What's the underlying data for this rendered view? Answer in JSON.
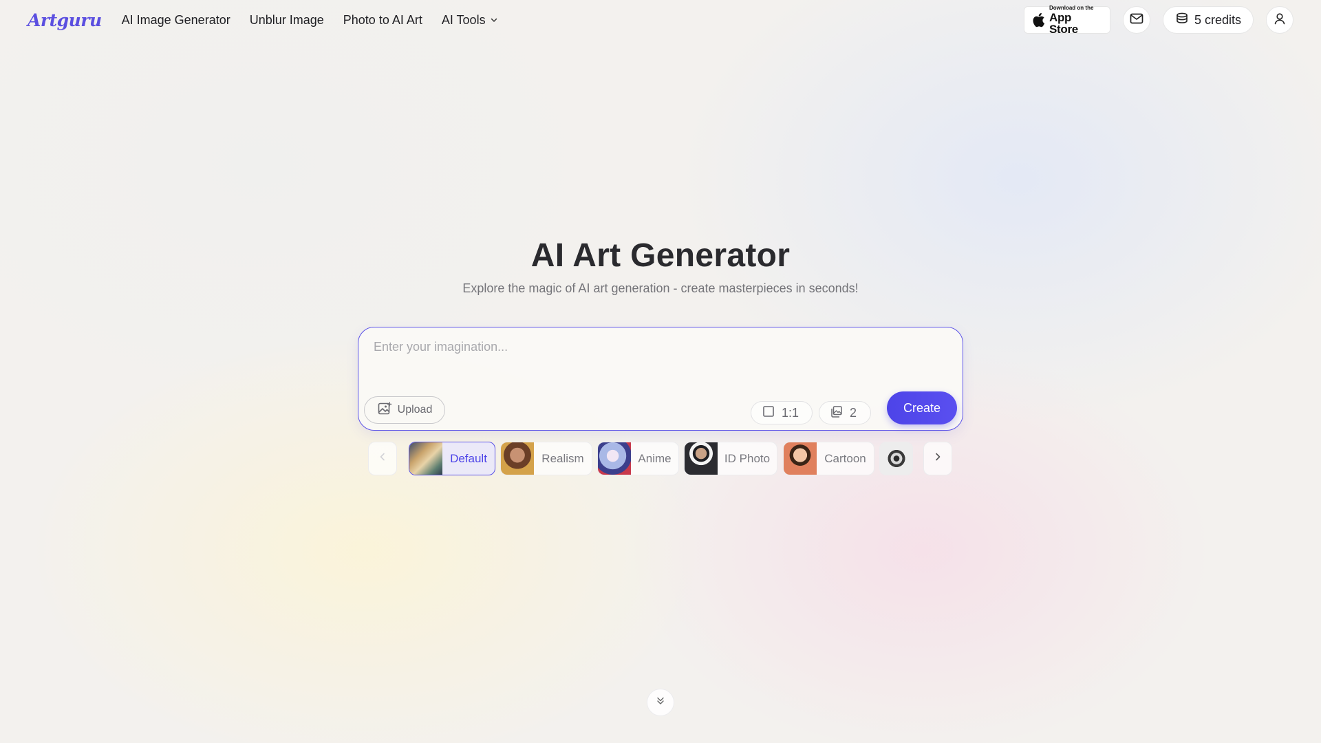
{
  "header": {
    "logo": "Artguru",
    "nav": [
      {
        "label": "AI Image Generator"
      },
      {
        "label": "Unblur Image"
      },
      {
        "label": "Photo to AI Art"
      },
      {
        "label": "AI Tools"
      }
    ],
    "app_store": {
      "small": "Download on the",
      "big": "App Store"
    },
    "credits": "5 credits"
  },
  "hero": {
    "title": "AI Art Generator",
    "subtitle": "Explore the magic of AI art generation - create masterpieces in seconds!"
  },
  "prompt": {
    "placeholder": "Enter your imagination...",
    "value": "",
    "upload_label": "Upload",
    "aspect_ratio": "1:1",
    "image_count": "2",
    "create_label": "Create"
  },
  "styles": [
    {
      "label": "Default",
      "selected": true
    },
    {
      "label": "Realism",
      "selected": false
    },
    {
      "label": "Anime",
      "selected": false
    },
    {
      "label": "ID Photo",
      "selected": false
    },
    {
      "label": "Cartoon",
      "selected": false
    }
  ],
  "colors": {
    "accent": "#5b4fe0",
    "create_button": "#4d44e8",
    "title_text": "#2a2a2e",
    "muted_text": "#747479"
  }
}
